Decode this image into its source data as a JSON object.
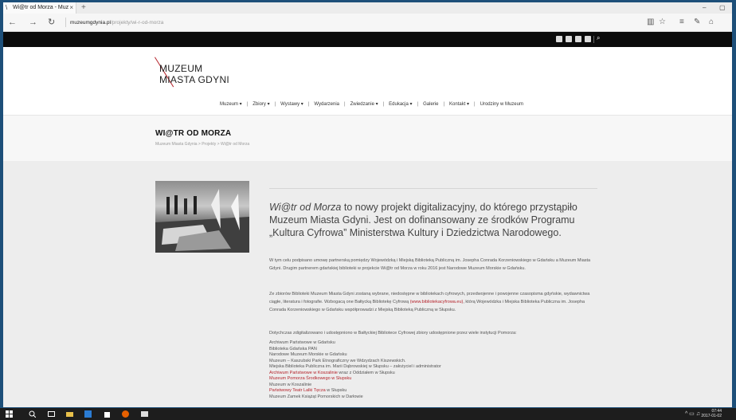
{
  "browser": {
    "tab_title": "Wi@tr od Morza - Muz",
    "tab_close": "×",
    "new_tab": "+",
    "url_domain": "muzeumgdynia.pl",
    "url_path": "/projekty/wi-r-od-morza",
    "win_minimize": "–",
    "win_maximize": "▢"
  },
  "site": {
    "logo_line1": "MUZEUM",
    "logo_line2": "MIASTA GDYNI",
    "menu": [
      "Muzeum ▾",
      "Zbiory ▾",
      "Wystawy ▾",
      "Wydarzenia",
      "Zwiedzanie ▾",
      "Edukacja ▾",
      "Galerie",
      "Kontakt ▾",
      "Urodziny w Muzeum"
    ],
    "page_title": "WI@TR OD MORZA",
    "breadcrumb": "Muzeum Miasta Gdynia > Projekty > Wi@tr od Morza",
    "lead_italic": "Wi@tr od Morza",
    "lead_rest": " to nowy projekt digitalizacyjny, do którego przystąpiło Muzeum Miasta Gdyni. Jest on dofinansowany ze środków Programu „Kultura Cyfrowa” Ministerstwa Kultury i Dziedzictwa Narodowego.",
    "p1": "W tym celu podpisano umowę partnerską pomiędzy Wojewódzką i Miejską Biblioteką Publiczną im. Josepha Conrada Korzeniowskiego w Gdańsku a Muzeum Miasta Gdyni. Drugim partnerem gdańskiej biblioteki w projekcie Wi@tr od Morza w roku 2016 jest Narodowe Muzeum Morskie w Gdańsku.",
    "p2_before": "Ze zbiorów Biblioteki Muzeum Miasta Gdyni zostaną wybrane, niedostępne w bibliotekach cyfrowych, przedwojenne i powojenne czasopisma gdyńskie, wydawnictwa ciągłe, literatura i fotografie. Wzbogacą one Bałtycką Bibliotekę Cyfrową ",
    "p2_link": "(www.bibliotekacyfrowa.eu)",
    "p2_after": ", którą Wojewódzka i Miejska Biblioteka Publiczna im. Josepha Conrada Korzeniowskiego w Gdańsku współprowadzi z Miejską Biblioteką Publiczną w Słupsku.",
    "p3": "Dotychczas zdigitalizowano i udostępniono w Bałtyckiej Bibliotece Cyfrowej zbiory udostępnione przez wiele instytucji Pomorza:",
    "institutions": [
      {
        "name": "Archiwum Państwowe w Gdańsku",
        "link": false
      },
      {
        "name": "Biblioteka Gdańska PAN",
        "link": false
      },
      {
        "name": "Narodowe Muzeum Morskie w Gdańsku",
        "link": false
      },
      {
        "name": "Muzeum – Kaszubski Park Etnograficzny we Wdzydzach Kiszewskich.",
        "link": false
      },
      {
        "name": "Miejska Biblioteka Publiczna im. Marii Dąbrowskiej w Słupsku – założyciel i administrator",
        "link": false
      },
      {
        "name": "Archiwum Państwowe w Koszalinie",
        "link": true,
        "suffix": " wraz z Oddziałem w Słupsku"
      },
      {
        "name": "Muzeum Pomorza Środkowego w Słupsku",
        "link": true
      },
      {
        "name": "Muzeum w Koszalinie",
        "link": false
      },
      {
        "name": "Państwowy Teatr Lalki Tęcza",
        "link": true,
        "suffix": " w Słupsku"
      },
      {
        "name": "Muzeum Zamek Książąt Pomorskich w Darłowie",
        "link": false
      }
    ]
  },
  "taskbar": {
    "time": "07:44",
    "date": "2017-01-02"
  },
  "colors": {
    "accent_red": "#b5232b",
    "taskbar": "#1d1d1d",
    "topstrip": "#0b0b0b"
  }
}
